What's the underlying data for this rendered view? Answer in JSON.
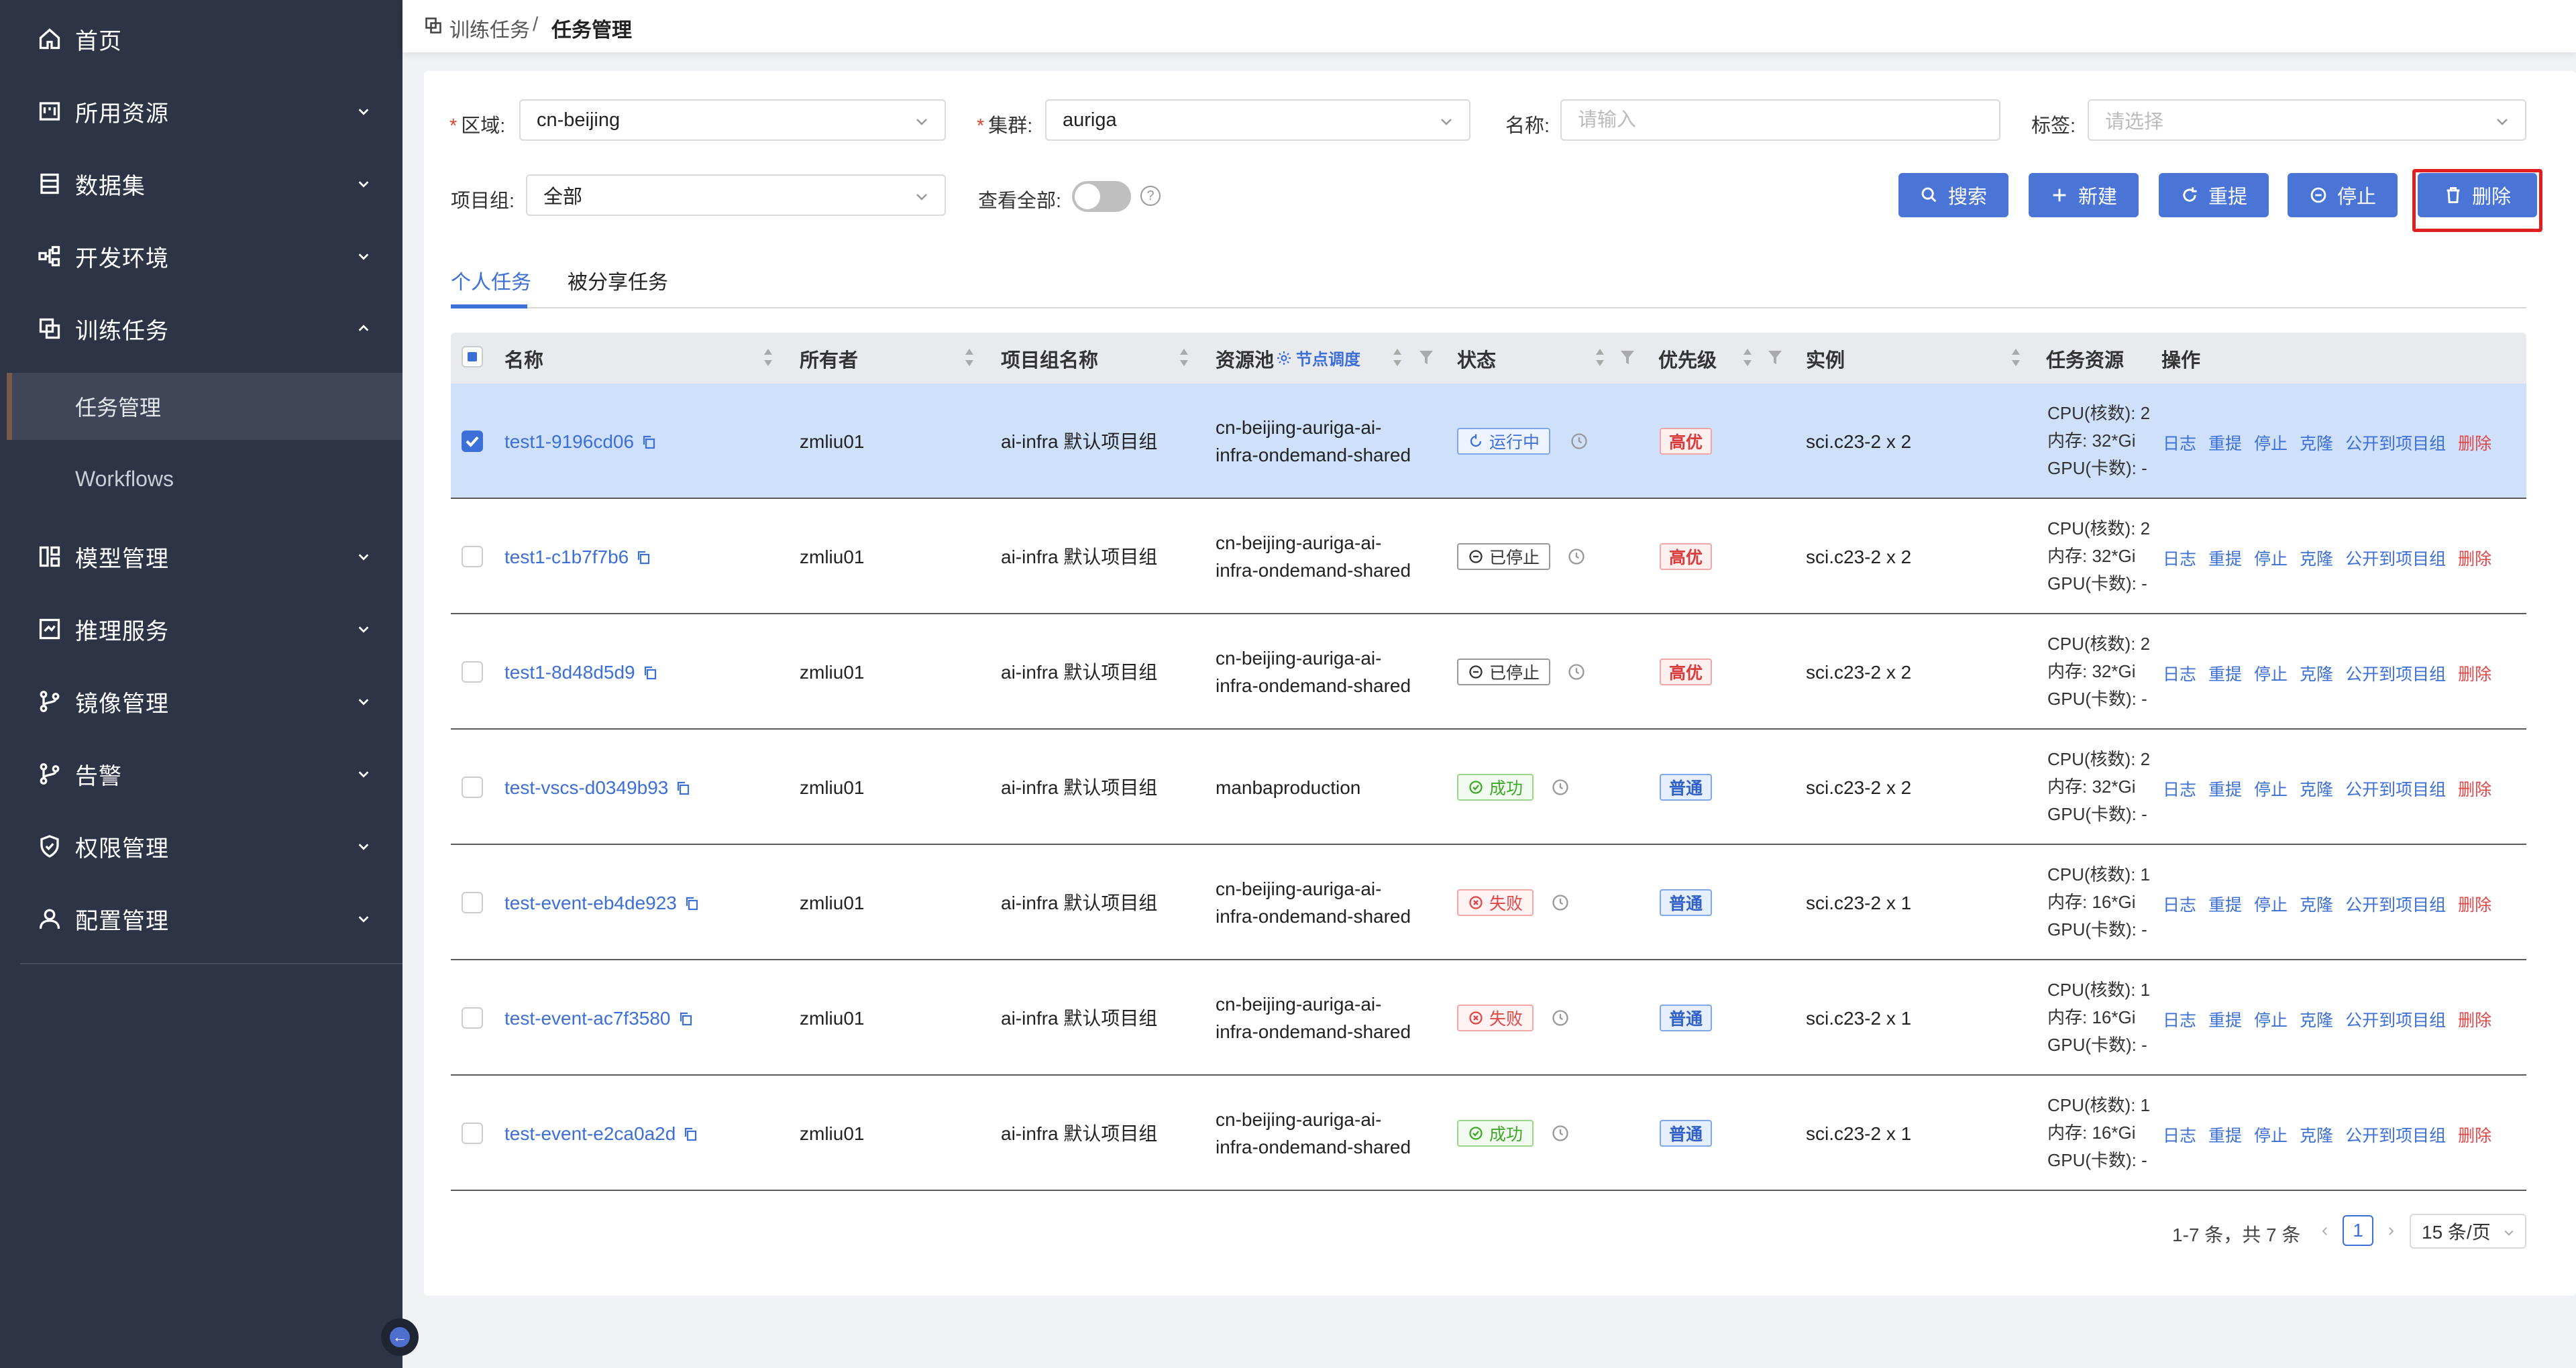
{
  "sidebar": {
    "items": [
      {
        "label": "首页",
        "icon": "home-icon"
      },
      {
        "label": "所用资源",
        "icon": "resource-icon"
      },
      {
        "label": "数据集",
        "icon": "dataset-icon"
      },
      {
        "label": "开发环境",
        "icon": "dev-env-icon"
      },
      {
        "label": "训练任务",
        "icon": "training-icon"
      },
      {
        "label": "模型管理",
        "icon": "model-icon"
      },
      {
        "label": "推理服务",
        "icon": "inference-icon"
      },
      {
        "label": "镜像管理",
        "icon": "image-branch-icon"
      },
      {
        "label": "告警",
        "icon": "alert-branch-icon"
      },
      {
        "label": "权限管理",
        "icon": "shield-icon"
      },
      {
        "label": "配置管理",
        "icon": "user-icon"
      }
    ],
    "sub_items": [
      {
        "label": "任务管理"
      },
      {
        "label": "Workflows"
      }
    ]
  },
  "breadcrumb": {
    "parent": "训练任务",
    "separator": "/",
    "current": "任务管理"
  },
  "filters": {
    "region_label": "区域:",
    "region_value": "cn-beijing",
    "cluster_label": "集群:",
    "cluster_value": "auriga",
    "name_label": "名称:",
    "name_placeholder": "请输入",
    "tag_label": "标签:",
    "tag_placeholder": "请选择",
    "project_label": "项目组:",
    "project_value": "全部",
    "view_all_label": "查看全部:",
    "help": "?"
  },
  "buttons": {
    "search": "搜索",
    "create": "新建",
    "resubmit": "重提",
    "stop": "停止",
    "delete": "删除"
  },
  "tabs": [
    {
      "label": "个人任务"
    },
    {
      "label": "被分享任务"
    }
  ],
  "table": {
    "columns": {
      "name": "名称",
      "owner": "所有者",
      "project": "项目组名称",
      "pool": "资源池",
      "pool_link": "节点调度",
      "status": "状态",
      "priority": "优先级",
      "instance": "实例",
      "resources": "任务资源",
      "actions": "操作"
    },
    "actions": {
      "log": "日志",
      "resubmit": "重提",
      "stop": "停止",
      "clone": "克隆",
      "publish": "公开到项目组",
      "delete": "删除"
    },
    "rows": [
      {
        "name": "test1-9196cd06",
        "owner": "zmliu01",
        "project": "ai-infra 默认项目组",
        "pool1": "cn-beijing-auriga-ai-",
        "pool2": "infra-ondemand-shared",
        "status": "运行中",
        "status_type": "running",
        "priority": "高优",
        "priority_type": "high",
        "instance": "sci.c23-2 x 2",
        "cpu": "CPU(核数): 2",
        "mem": "内存: 32*Gi",
        "gpu": "GPU(卡数): -",
        "selected": true
      },
      {
        "name": "test1-c1b7f7b6",
        "owner": "zmliu01",
        "project": "ai-infra 默认项目组",
        "pool1": "cn-beijing-auriga-ai-",
        "pool2": "infra-ondemand-shared",
        "status": "已停止",
        "status_type": "stopped",
        "priority": "高优",
        "priority_type": "high",
        "instance": "sci.c23-2 x 2",
        "cpu": "CPU(核数): 2",
        "mem": "内存: 32*Gi",
        "gpu": "GPU(卡数): -",
        "selected": false
      },
      {
        "name": "test1-8d48d5d9",
        "owner": "zmliu01",
        "project": "ai-infra 默认项目组",
        "pool1": "cn-beijing-auriga-ai-",
        "pool2": "infra-ondemand-shared",
        "status": "已停止",
        "status_type": "stopped",
        "priority": "高优",
        "priority_type": "high",
        "instance": "sci.c23-2 x 2",
        "cpu": "CPU(核数): 2",
        "mem": "内存: 32*Gi",
        "gpu": "GPU(卡数): -",
        "selected": false
      },
      {
        "name": "test-vscs-d0349b93",
        "owner": "zmliu01",
        "project": "ai-infra 默认项目组",
        "pool1": "manbaproduction",
        "pool2": "",
        "status": "成功",
        "status_type": "success",
        "priority": "普通",
        "priority_type": "normal",
        "instance": "sci.c23-2 x 2",
        "cpu": "CPU(核数): 2",
        "mem": "内存: 32*Gi",
        "gpu": "GPU(卡数): -",
        "selected": false
      },
      {
        "name": "test-event-eb4de923",
        "owner": "zmliu01",
        "project": "ai-infra 默认项目组",
        "pool1": "cn-beijing-auriga-ai-",
        "pool2": "infra-ondemand-shared",
        "status": "失败",
        "status_type": "failed",
        "priority": "普通",
        "priority_type": "normal",
        "instance": "sci.c23-2 x 1",
        "cpu": "CPU(核数): 1",
        "mem": "内存: 16*Gi",
        "gpu": "GPU(卡数): -",
        "selected": false
      },
      {
        "name": "test-event-ac7f3580",
        "owner": "zmliu01",
        "project": "ai-infra 默认项目组",
        "pool1": "cn-beijing-auriga-ai-",
        "pool2": "infra-ondemand-shared",
        "status": "失败",
        "status_type": "failed",
        "priority": "普通",
        "priority_type": "normal",
        "instance": "sci.c23-2 x 1",
        "cpu": "CPU(核数): 1",
        "mem": "内存: 16*Gi",
        "gpu": "GPU(卡数): -",
        "selected": false
      },
      {
        "name": "test-event-e2ca0a2d",
        "owner": "zmliu01",
        "project": "ai-infra 默认项目组",
        "pool1": "cn-beijing-auriga-ai-",
        "pool2": "infra-ondemand-shared",
        "status": "成功",
        "status_type": "success",
        "priority": "普通",
        "priority_type": "normal",
        "instance": "sci.c23-2 x 1",
        "cpu": "CPU(核数): 1",
        "mem": "内存: 16*Gi",
        "gpu": "GPU(卡数): -",
        "selected": false
      }
    ]
  },
  "pagination": {
    "total": "1-7 条，共 7 条",
    "current_page": "1",
    "page_size": "15 条/页"
  },
  "colors": {
    "sidebar_bg": "#2d3446",
    "accent": "#3c6fd8",
    "button": "#4a74d6",
    "danger": "#e04646",
    "selected_row": "#cfe0fb"
  }
}
